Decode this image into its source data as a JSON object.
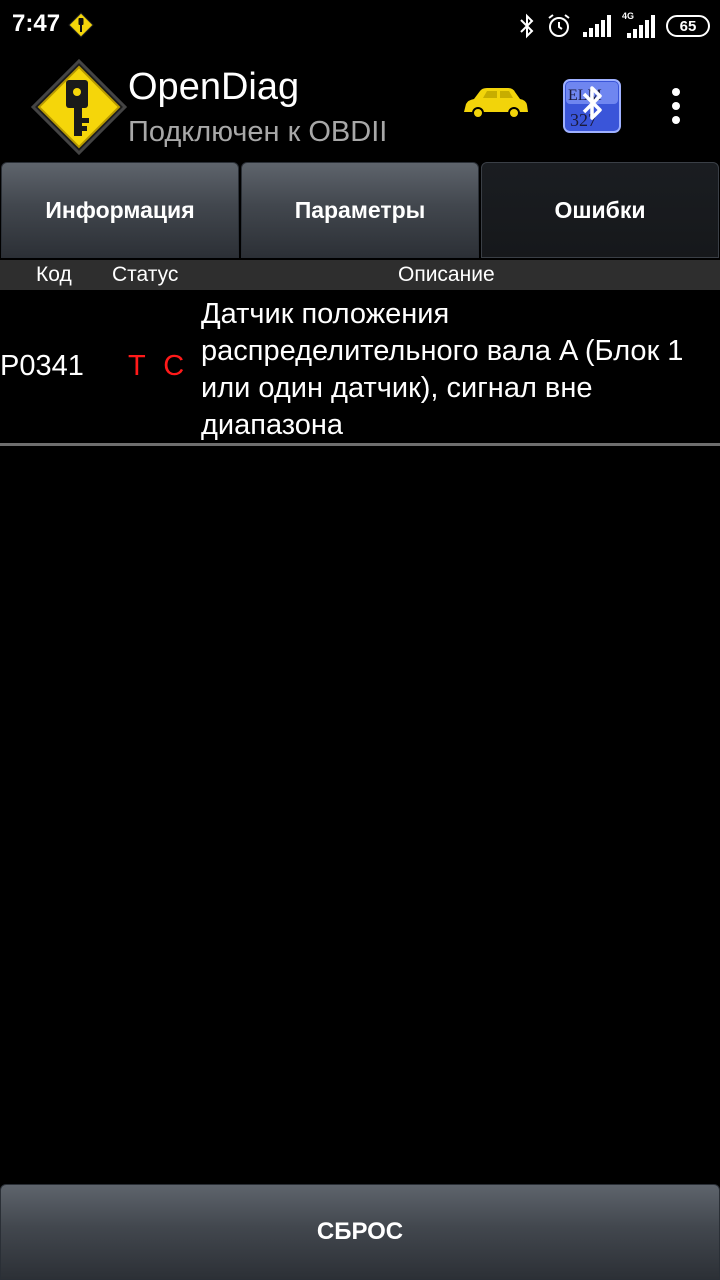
{
  "status_bar": {
    "time": "7:47",
    "network": "4G",
    "battery": "65",
    "icons": [
      "app-notification-icon",
      "bluetooth-icon",
      "alarm-icon",
      "signal-icon",
      "signal-4g-icon",
      "battery-icon"
    ]
  },
  "app_bar": {
    "title": "OpenDiag",
    "subtitle": "Подключен к OBDII",
    "logo_icon": "key-diamond-icon",
    "car_icon": "car-icon",
    "bluetooth_icon": "bluetooth-elm327-icon",
    "menu_icon": "overflow-menu-icon",
    "logo_color": "#f5d60a",
    "car_color": "#f2d40a"
  },
  "tabs": [
    {
      "label": "Информация",
      "active": false
    },
    {
      "label": "Параметры",
      "active": false
    },
    {
      "label": "Ошибки",
      "active": true
    }
  ],
  "table": {
    "columns": [
      "Код",
      "Статус",
      "Описание"
    ],
    "rows": [
      {
        "code": "P0341",
        "status": "T C",
        "description": "Датчик положения распределительного вала A (Блок 1 или один датчик), сигнал вне диапазона"
      }
    ]
  },
  "reset_label": "СБРОС",
  "colors": {
    "background": "#000000",
    "status_red": "#ff1a1a",
    "subtitle_gray": "#a8a8a8"
  }
}
